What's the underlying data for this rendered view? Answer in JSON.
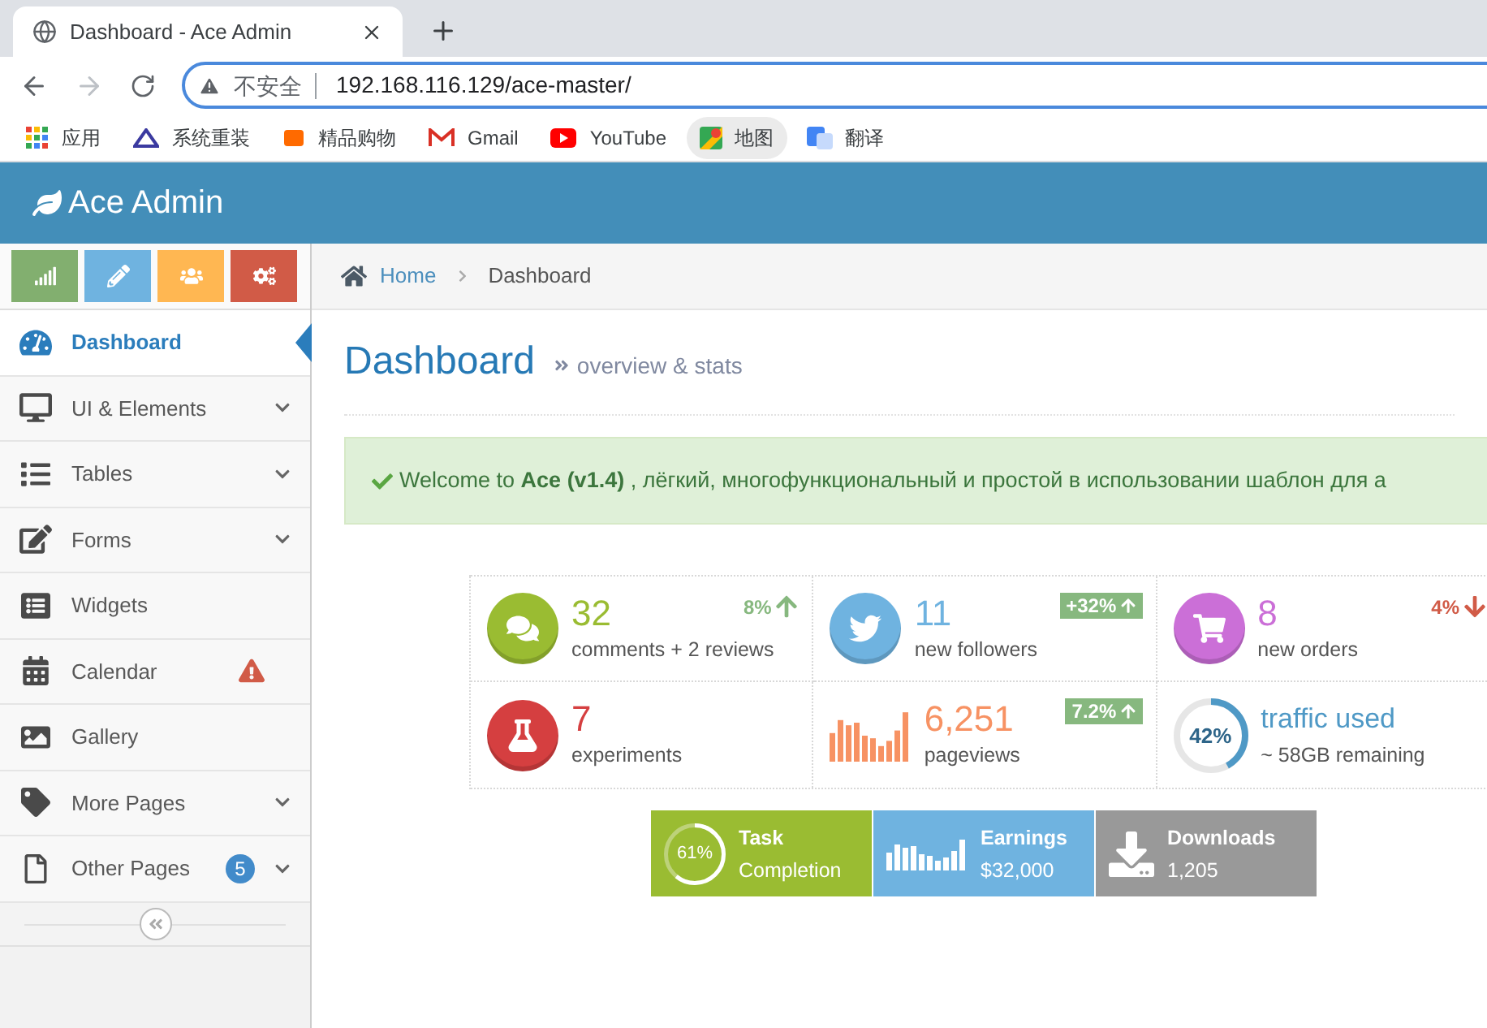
{
  "browser": {
    "tab_title": "Dashboard - Ace Admin",
    "security_label": "不安全",
    "url": "192.168.116.129/ace-master/",
    "bookmarks": [
      {
        "label": "应用",
        "hovered": false
      },
      {
        "label": "系统重装",
        "hovered": false
      },
      {
        "label": "精品购物",
        "hovered": false
      },
      {
        "label": "Gmail",
        "hovered": false
      },
      {
        "label": "YouTube",
        "hovered": false
      },
      {
        "label": "地图",
        "hovered": true
      },
      {
        "label": "翻译",
        "hovered": false
      }
    ]
  },
  "navbar": {
    "brand": "Ace Admin"
  },
  "sidebar": {
    "items": [
      {
        "label": "Dashboard",
        "selected": true,
        "expandable": false
      },
      {
        "label": "UI & Elements",
        "selected": false,
        "expandable": true
      },
      {
        "label": "Tables",
        "selected": false,
        "expandable": true
      },
      {
        "label": "Forms",
        "selected": false,
        "expandable": true
      },
      {
        "label": "Widgets",
        "selected": false,
        "expandable": false
      },
      {
        "label": "Calendar",
        "selected": false,
        "expandable": false,
        "alert": true
      },
      {
        "label": "Gallery",
        "selected": false,
        "expandable": false
      },
      {
        "label": "More Pages",
        "selected": false,
        "expandable": true
      },
      {
        "label": "Other Pages",
        "selected": false,
        "expandable": true,
        "badge": "5"
      }
    ]
  },
  "breadcrumb": [
    "Home",
    "Dashboard"
  ],
  "page_header": {
    "title": "Dashboard",
    "subtitle": "overview & stats"
  },
  "alert": {
    "text": "Welcome to **Ace** **(v1.4)** , лёгкий, многофункциональный и простой в использовании шаблон для а"
  },
  "infoboxes": [
    {
      "kind": "icon",
      "number": "32",
      "label": "comments + 2 reviews",
      "change": {
        "text": "8%",
        "kind": "up"
      }
    },
    {
      "kind": "icon",
      "number": "11",
      "label": "new followers",
      "change": {
        "text": "+32%",
        "kind": "badge"
      }
    },
    {
      "kind": "icon",
      "number": "8",
      "label": "new orders",
      "change": {
        "text": "4%",
        "kind": "down"
      }
    },
    {
      "kind": "icon",
      "number": "7",
      "label": "experiments"
    },
    {
      "kind": "sparkline",
      "number": "6,251",
      "label": "pageviews",
      "change": {
        "text": "7.2%",
        "kind": "badge"
      }
    },
    {
      "kind": "pie",
      "percent": "42%",
      "level": 0.42,
      "number": "traffic used",
      "label": "~ 58GB remaining"
    }
  ],
  "summary_boxes": [
    {
      "kind": "pie",
      "percent": "61%",
      "level": 0.61,
      "title": "Task",
      "value": "Completion"
    },
    {
      "kind": "sparkline",
      "title": "Earnings",
      "value": "$32,000"
    },
    {
      "kind": "download",
      "title": "Downloads",
      "value": "1,205"
    }
  ]
}
